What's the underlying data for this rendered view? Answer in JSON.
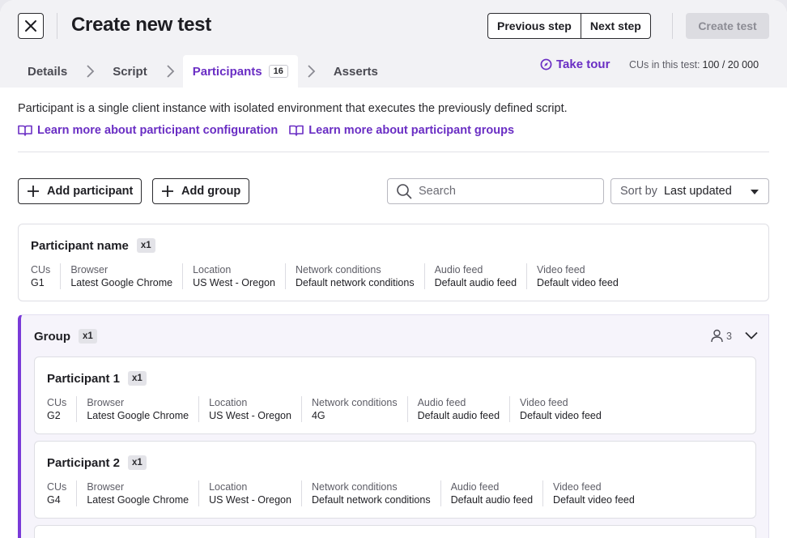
{
  "header": {
    "title": "Create new test",
    "previous_label": "Previous step",
    "next_label": "Next step",
    "create_label": "Create test"
  },
  "steps": [
    {
      "label": "Details"
    },
    {
      "label": "Script"
    },
    {
      "label": "Participants",
      "badge": "16",
      "active": true
    },
    {
      "label": "Asserts"
    }
  ],
  "tour_label": "Take tour",
  "cus": {
    "label": "CUs in this test:",
    "value": "100 / 20 000"
  },
  "description": "Participant is a single client instance with isolated environment that executes the previously defined script.",
  "links": {
    "config": "Learn more about participant configuration",
    "groups": "Learn more about participant groups"
  },
  "toolbar": {
    "add_participant": "Add participant",
    "add_group": "Add group",
    "search_placeholder": "Search",
    "sort_label": "Sort by",
    "sort_value": "Last updated"
  },
  "labels": {
    "cus": "CUs",
    "browser": "Browser",
    "location": "Location",
    "network": "Network conditions",
    "audio": "Audio feed",
    "video": "Video feed"
  },
  "participant": {
    "name": "Participant name",
    "mult": "x1",
    "cus": "G1",
    "browser": "Latest Google Chrome",
    "location": "US West - Oregon",
    "network": "Default network conditions",
    "audio": "Default audio feed",
    "video": "Default video feed"
  },
  "group": {
    "name": "Group",
    "mult": "x1",
    "count": "3",
    "participants": [
      {
        "name": "Participant 1",
        "mult": "x1",
        "cus": "G2",
        "browser": "Latest Google Chrome",
        "location": "US West - Oregon",
        "network": "4G",
        "audio": "Default audio feed",
        "video": "Default video feed"
      },
      {
        "name": "Participant 2",
        "mult": "x1",
        "cus": "G4",
        "browser": "Latest Google Chrome",
        "location": "US West - Oregon",
        "network": "Default network conditions",
        "audio": "Default audio feed",
        "video": "Default video feed"
      }
    ]
  },
  "colors": {
    "accent": "#6a2ec4",
    "group_bar": "#7a3ad8",
    "topbar_bg": "#f2f2f5"
  }
}
